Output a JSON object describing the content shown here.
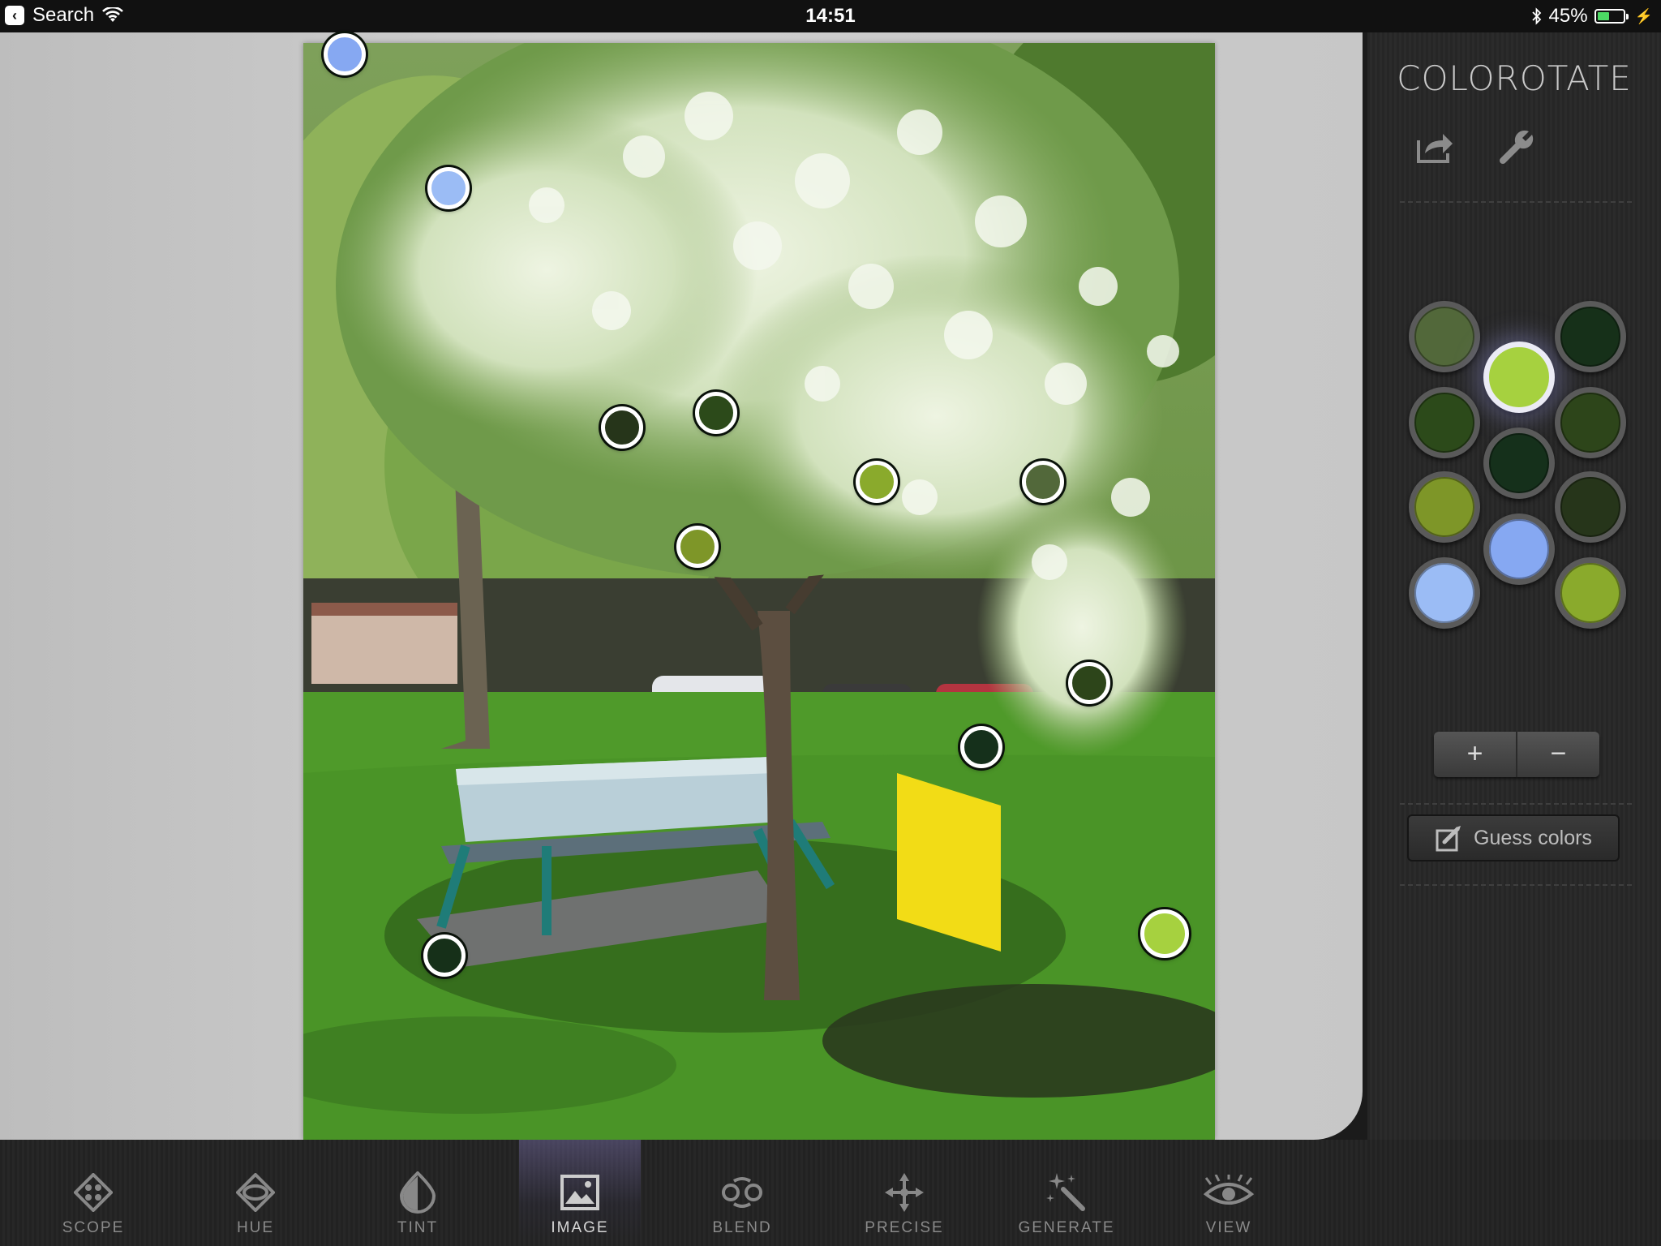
{
  "status_bar": {
    "back_label": "Search",
    "time": "14:51",
    "battery": "45%",
    "battery_level": 0.45
  },
  "app": {
    "logo": "COLOROTATE"
  },
  "panel": {
    "share_icon": "share-icon",
    "settings_icon": "wrench-icon",
    "plus_label": "+",
    "minus_label": "−",
    "guess_label": "Guess colors",
    "palette": [
      {
        "color": "#52683a",
        "selected": false
      },
      {
        "color": "#a6d13f",
        "selected": true
      },
      {
        "color": "#163019",
        "selected": false
      },
      {
        "color": "#2c4a1a",
        "selected": false
      },
      {
        "color": "#15301b",
        "selected": false
      },
      {
        "color": "#2d451a",
        "selected": false
      },
      {
        "color": "#7e9628",
        "selected": false
      },
      {
        "color": "#86a8f2",
        "selected": false
      },
      {
        "color": "#26351a",
        "selected": false
      },
      {
        "color": "#9bbcf5",
        "selected": false
      },
      {
        "color": "#8aaa2c",
        "selected": false
      }
    ]
  },
  "image_markers": [
    {
      "color": "#86a8f2"
    },
    {
      "color": "#9bbcf5"
    },
    {
      "color": "#26351a"
    },
    {
      "color": "#2c4a1a"
    },
    {
      "color": "#8aaa2c"
    },
    {
      "color": "#52683a"
    },
    {
      "color": "#7e9628"
    },
    {
      "color": "#2d451a"
    },
    {
      "color": "#15301b"
    },
    {
      "color": "#163019"
    },
    {
      "color": "#a6d13f"
    }
  ],
  "toolbar": {
    "items": [
      {
        "label": "SCOPE",
        "icon": "scope-icon"
      },
      {
        "label": "HUE",
        "icon": "hue-icon"
      },
      {
        "label": "TINT",
        "icon": "tint-icon"
      },
      {
        "label": "IMAGE",
        "icon": "image-icon",
        "active": true
      },
      {
        "label": "BLEND",
        "icon": "blend-icon"
      },
      {
        "label": "PRECISE",
        "icon": "precise-icon"
      },
      {
        "label": "GENERATE",
        "icon": "generate-icon"
      },
      {
        "label": "VIEW",
        "icon": "view-icon"
      }
    ]
  }
}
